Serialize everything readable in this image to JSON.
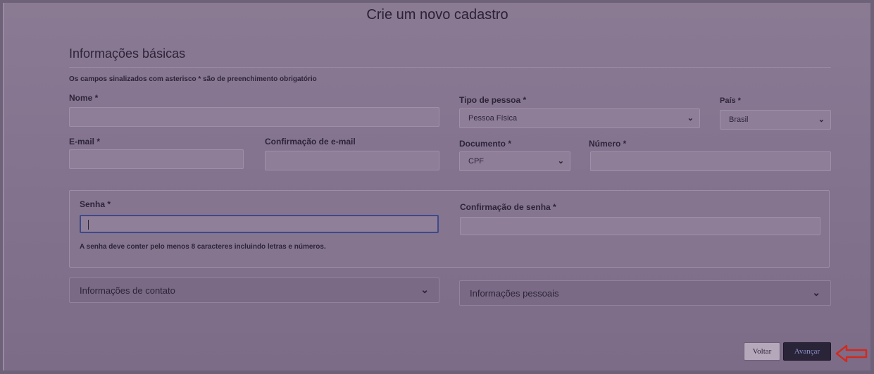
{
  "page": {
    "title": "Crie um novo cadastro"
  },
  "basic": {
    "title": "Informações básicas",
    "note": "Os campos sinalizados com asterisco * são de preenchimento obrigatório"
  },
  "fields": {
    "nome": {
      "label": "Nome *",
      "value": ""
    },
    "tipo_pessoa": {
      "label": "Tipo de pessoa *",
      "value": "Pessoa Física"
    },
    "pais": {
      "label": "País *",
      "value": "Brasil"
    },
    "email": {
      "label": "E-mail *",
      "value": ""
    },
    "email_confirm": {
      "label": "Confirmação de e-mail",
      "value": ""
    },
    "documento": {
      "label": "Documento *",
      "value": "CPF"
    },
    "numero": {
      "label": "Número *",
      "value": ""
    },
    "senha": {
      "label": "Senha *",
      "value": ""
    },
    "senha_confirm": {
      "label": "Confirmação de senha *",
      "value": ""
    },
    "senha_hint": "A senha deve conter pelo menos 8 caracteres incluindo letras e números."
  },
  "sections": {
    "contato": "Informações de contato",
    "pessoais": "Informações pessoais"
  },
  "buttons": {
    "voltar": "Voltar",
    "avancar": "Avançar"
  },
  "icons": {
    "chevron": "chevron-down-icon",
    "pointer": "left-arrow-icon"
  },
  "colors": {
    "primary_button": "#2a2438",
    "arrow": "#d22a1e"
  }
}
